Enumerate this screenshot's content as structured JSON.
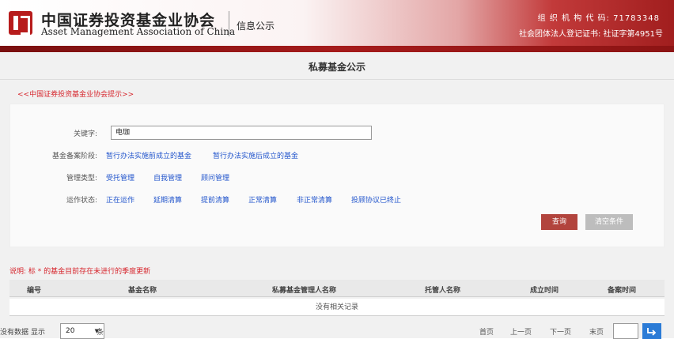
{
  "header": {
    "logo_cn": "中国证券投资基金业协会",
    "logo_en": "Asset Management Association of China",
    "tag": "信息公示",
    "org_code": "组 织 机 构 代 码: 71783348",
    "org_reg": "社会团体法人登记证书: 社证字第4951号"
  },
  "page": {
    "title": "私募基金公示",
    "notice_link": "<<中国证券投资基金业协会提示>>"
  },
  "search": {
    "keyword_label": "关键字:",
    "keyword_value": "电珈",
    "stage_label": "基金备案阶段:",
    "stage_options": [
      "暂行办法实施前成立的基金",
      "暂行办法实施后成立的基金"
    ],
    "manage_label": "管理类型:",
    "manage_options": [
      "受托管理",
      "自我管理",
      "顾问管理"
    ],
    "status_label": "运作状态:",
    "status_options": [
      "正在运作",
      "延期清算",
      "提前清算",
      "正常清算",
      "非正常清算",
      "投顾协议已终止"
    ],
    "query_button": "查询",
    "clear_button": "清空条件"
  },
  "table": {
    "explain": "说明: 标 * 的基金目前存在未进行的季度更新",
    "columns": [
      "编号",
      "基金名称",
      "私募基金管理人名称",
      "托管人名称",
      "成立时间",
      "备案时间"
    ],
    "empty_text": "没有相关记录"
  },
  "pager": {
    "nodata": "没有数据",
    "show_label": "显示",
    "page_size": "20",
    "unit": "条",
    "first": "首页",
    "prev": "上一页",
    "next": "下一页",
    "last": "末页"
  },
  "colors": {
    "brand_red": "#b71c1c",
    "link_blue": "#2255cc",
    "notice_red": "#d7282f",
    "jump_blue": "#2b7bd6"
  }
}
